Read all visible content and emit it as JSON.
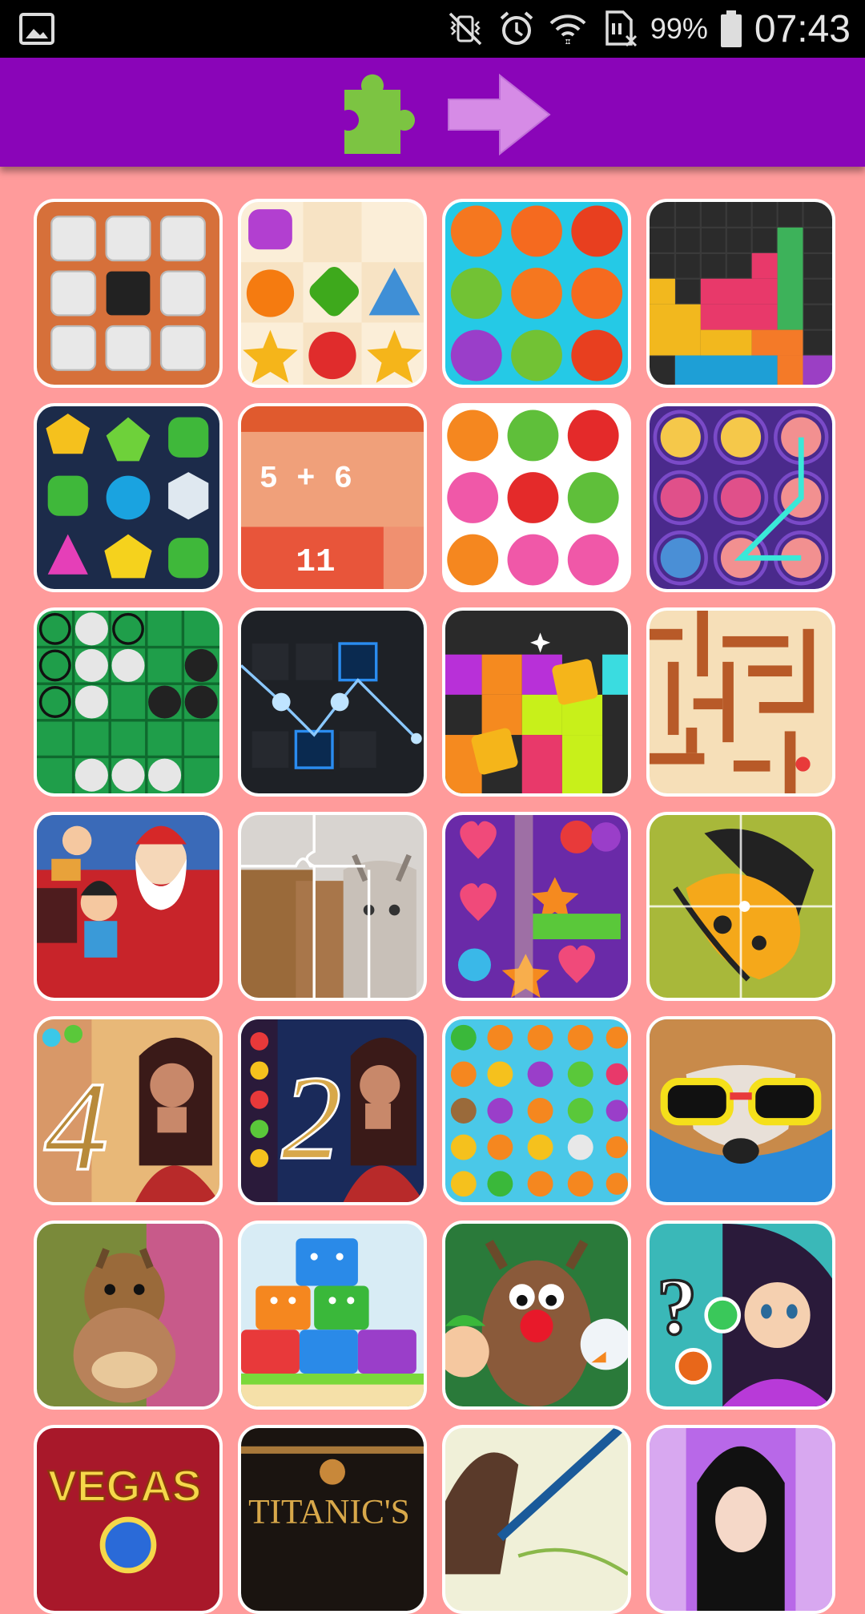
{
  "status_bar": {
    "battery_percent": "99%",
    "time": "07:43",
    "icons": [
      "gallery-icon",
      "vibrate-mute-icon",
      "alarm-icon",
      "wifi-icon",
      "no-sim-icon",
      "battery-icon"
    ]
  },
  "toolbar": {
    "background": "#8a05b8",
    "icons": [
      "puzzle-icon",
      "forward-arrow-icon"
    ]
  },
  "games": {
    "tiles": [
      {
        "id": "sliding-tiles"
      },
      {
        "id": "gem-match-pastel"
      },
      {
        "id": "candy-balls-cyan"
      },
      {
        "id": "block-columns"
      },
      {
        "id": "jewel-crush-dark"
      },
      {
        "id": "math-sum",
        "equation": "5 + 6",
        "answer": "11"
      },
      {
        "id": "candy-balls-white"
      },
      {
        "id": "linked-orbs"
      },
      {
        "id": "nonogram-green"
      },
      {
        "id": "neon-reflect"
      },
      {
        "id": "shapes-drop"
      },
      {
        "id": "wood-maze"
      },
      {
        "id": "santa-jigsaw"
      },
      {
        "id": "cat-jigsaw"
      },
      {
        "id": "purple-hearts-match"
      },
      {
        "id": "butterfly-jigsaw"
      },
      {
        "id": "jewel-lady-4"
      },
      {
        "id": "jewel-lady-2"
      },
      {
        "id": "fruit-faces"
      },
      {
        "id": "sunglasses-dog-jigsaw"
      },
      {
        "id": "squirrel-jigsaw"
      },
      {
        "id": "block-faces-stack"
      },
      {
        "id": "christmas-friends"
      },
      {
        "id": "girl-quiz"
      },
      {
        "id": "vegas",
        "label": "VEGAS"
      },
      {
        "id": "titanic",
        "label": "TITANIC'S"
      },
      {
        "id": "sketch-girl"
      },
      {
        "id": "dress-up-girl"
      }
    ]
  }
}
